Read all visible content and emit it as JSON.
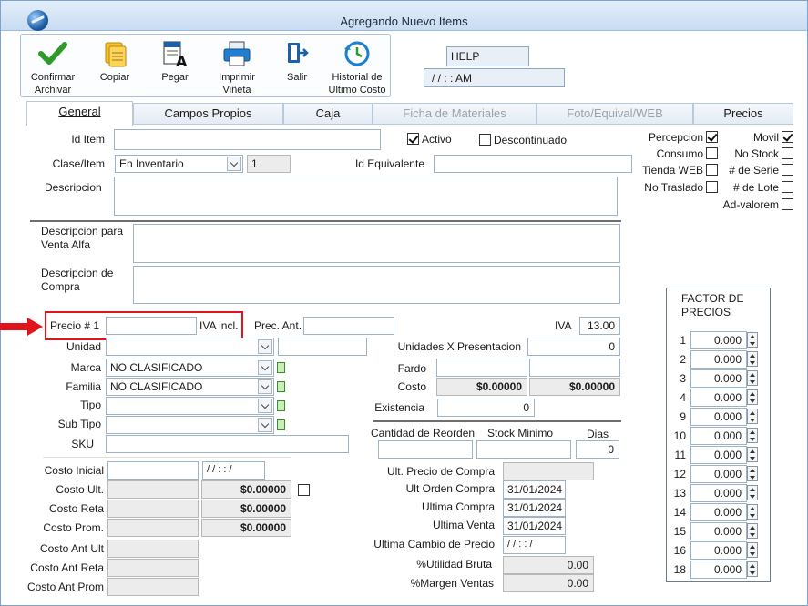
{
  "window": {
    "title": "Agregando Nuevo Items"
  },
  "toolbar": {
    "confirm": "Confirmar Archivar",
    "copy": "Copiar",
    "paste": "Pegar",
    "print": "Imprimir Viñeta",
    "exit": "Salir",
    "history": "Historial de Ultimo Costo"
  },
  "help": {
    "label": "HELP",
    "datetime": "/ /      :  :   AM"
  },
  "tabs": [
    "General",
    "Campos Propios",
    "Caja",
    "Ficha de Materiales",
    "Foto/Equival/WEB",
    "Precios"
  ],
  "general": {
    "id_item_label": "Id Item",
    "activo_label": "Activo",
    "descontinuado_label": "Descontinuado",
    "clase_label": "Clase/Item",
    "clase_value": "En Inventario",
    "clase_num": "1",
    "id_equivalente_label": "Id Equivalente",
    "descripcion_label": "Descripcion",
    "desc_venta_label": "Descripcion para Venta Alfa",
    "desc_compra_label": "Descripcion de Compra",
    "flags": {
      "percepcion": "Percepcion",
      "movil": "Movil",
      "consumo": "Consumo",
      "no_stock": "No Stock",
      "tienda_web": "Tienda WEB",
      "num_serie": "# de Serie",
      "no_traslado": "No Traslado",
      "num_lote": "# de Lote",
      "ad_valorem": "Ad-valorem"
    },
    "precio1_label": "Precio # 1",
    "iva_incl_label": "IVA incl.",
    "prec_ant_label": "Prec. Ant.",
    "iva_label": "IVA",
    "iva_value": "13.00",
    "unidad_label": "Unidad",
    "marca_label": "Marca",
    "marca_value": "NO CLASIFICADO",
    "familia_label": "Familia",
    "familia_value": "NO CLASIFICADO",
    "tipo_label": "Tipo",
    "subtipo_label": "Sub Tipo",
    "sku_label": "SKU",
    "unidades_x_pres_label": "Unidades X Presentacion",
    "unidades_x_pres_value": "0",
    "fardo_label": "Fardo",
    "costo_label": "Costo",
    "costo_value1": "$0.00000",
    "costo_value2": "$0.00000",
    "existencia_label": "Existencia",
    "existencia_value": "0",
    "cant_reorden_label": "Cantidad de Reorden",
    "stock_minimo_label": "Stock Minimo",
    "dias_label": "Dias",
    "dias_value": "0",
    "costo_inicial_label": "Costo Inicial",
    "costo_inicial_date": "/ /       :  : /",
    "costo_ult_label": "Costo Ult.",
    "costo_ult_value": "$0.00000",
    "costo_reta_label": "Costo Reta",
    "costo_reta_value": "$0.00000",
    "costo_prom_label": "Costo Prom.",
    "costo_prom_value": "$0.00000",
    "costo_ant_ult_label": "Costo Ant Ult",
    "costo_ant_reta_label": "Costo Ant Reta",
    "costo_ant_prom_label": "Costo Ant Prom",
    "ult_precio_compra_label": "Ult. Precio de Compra",
    "ult_orden_compra_label": "Ult Orden Compra",
    "ult_orden_compra_value": "31/01/2024",
    "ultima_compra_label": "Ultima Compra",
    "ultima_compra_value": "31/01/2024",
    "ultima_venta_label": "Ultima Venta",
    "ultima_venta_value": "31/01/2024",
    "ultima_cambio_precio_label": "Ultima Cambio de Precio",
    "ultima_cambio_precio_value": "/ /       :  : /",
    "utilidad_bruta_label": "%Utilidad Bruta",
    "utilidad_bruta_value": "0.00",
    "margen_ventas_label": "%Margen Ventas",
    "margen_ventas_value": "0.00"
  },
  "factor": {
    "title": "FACTOR DE PRECIOS",
    "rows": [
      {
        "n": "1",
        "v": "0.000"
      },
      {
        "n": "2",
        "v": "0.000"
      },
      {
        "n": "3",
        "v": "0.000"
      },
      {
        "n": "4",
        "v": "0.000"
      },
      {
        "n": "9",
        "v": "0.000"
      },
      {
        "n": "10",
        "v": "0.000"
      },
      {
        "n": "11",
        "v": "0.000"
      },
      {
        "n": "12",
        "v": "0.000"
      },
      {
        "n": "13",
        "v": "0.000"
      },
      {
        "n": "14",
        "v": "0.000"
      },
      {
        "n": "15",
        "v": "0.000"
      },
      {
        "n": "16",
        "v": "0.000"
      },
      {
        "n": "18",
        "v": "0.000"
      }
    ]
  },
  "colors": {
    "highlight": "#e0141c",
    "titlebar": "#c9dcf2"
  }
}
